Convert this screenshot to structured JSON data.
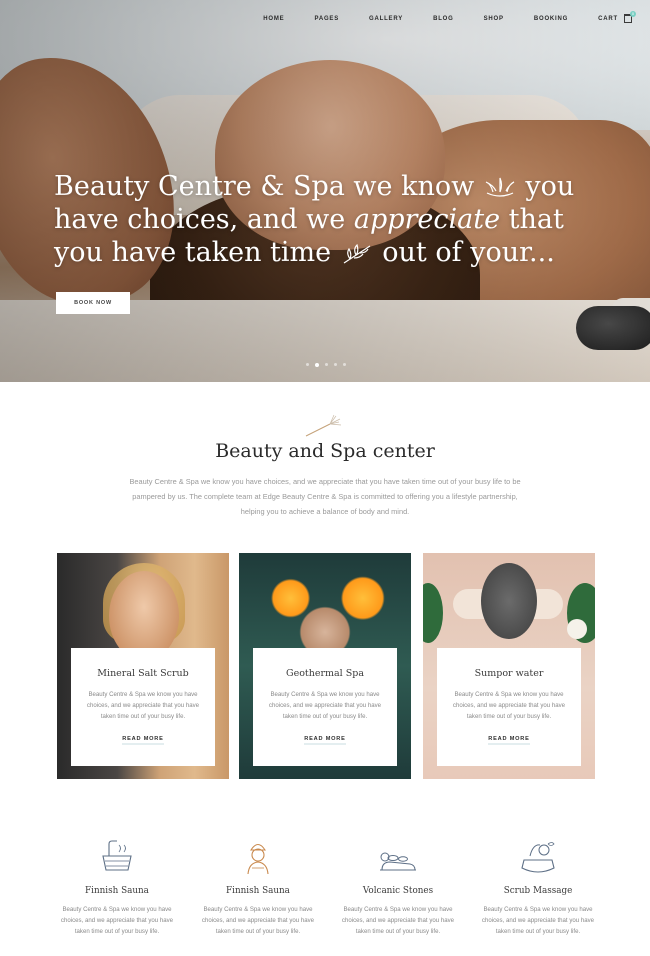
{
  "nav": {
    "items": [
      "HOME",
      "PAGES",
      "GALLERY",
      "BLOG",
      "SHOP",
      "BOOKING",
      "CART"
    ],
    "cart_count": "0",
    "accent_color": "#7ad0c4"
  },
  "hero": {
    "title_part1": "Beauty Centre & Spa we know ",
    "title_part2": " you have choices, and we ",
    "title_emphasis": "appreciate",
    "title_part3": " that you have taken time ",
    "title_part4": " out of your...",
    "button_label": "BOOK NOW",
    "slides": {
      "count": 5,
      "active": 1
    }
  },
  "intro": {
    "title": "Beauty and Spa center",
    "text": "Beauty Centre & Spa we know you have choices, and we appreciate that you have taken time out of your busy life to be pampered by us. The complete team at Edge Beauty Centre & Spa is committed to offering you a lifestyle partnership, helping you to achieve a balance of body and mind."
  },
  "cards": [
    {
      "title": "Mineral Salt Scrub",
      "text": "Beauty Centre & Spa we know you have choices, and we appreciate that you have taken time out of your busy life.",
      "link": "READ MORE"
    },
    {
      "title": "Geothermal Spa",
      "text": "Beauty Centre & Spa we know you have choices, and we appreciate that you have taken time out of your busy life.",
      "link": "READ MORE"
    },
    {
      "title": "Sumpor water",
      "text": "Beauty Centre & Spa we know you have choices, and we appreciate that you have taken time out of your busy life.",
      "link": "READ MORE"
    }
  ],
  "features": [
    {
      "icon": "sauna-bucket-icon",
      "title": "Finnish Sauna",
      "text": "Beauty Centre & Spa we know you have choices, and we appreciate that you have taken time out of your busy life."
    },
    {
      "icon": "towel-head-woman-icon",
      "title": "Finnish Sauna",
      "text": "Beauty Centre & Spa we know you have choices, and we appreciate that you have taken time out of your busy life."
    },
    {
      "icon": "hot-stones-massage-icon",
      "title": "Volcanic Stones",
      "text": "Beauty Centre & Spa we know you have choices, and we appreciate that you have taken time out of your busy life."
    },
    {
      "icon": "scrub-massage-icon",
      "title": "Scrub Massage",
      "text": "Beauty Centre & Spa we know you have choices, and we appreciate that you have taken time out of your busy life."
    }
  ]
}
